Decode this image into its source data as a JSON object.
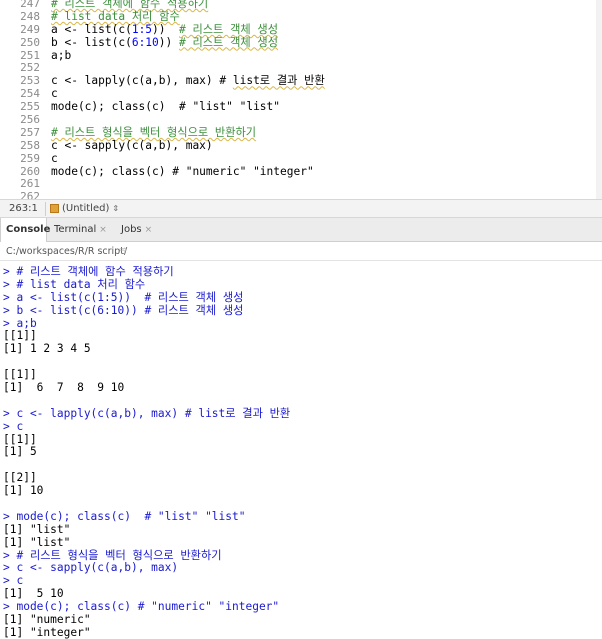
{
  "editor": {
    "lines": [
      {
        "n": "247",
        "segments": [
          {
            "t": "# 리스트 객체에 함수 적용하기",
            "c": "cmt",
            "s": true
          }
        ]
      },
      {
        "n": "248",
        "segments": [
          {
            "t": "# list data 처리 함수",
            "c": "cmt",
            "s": true
          }
        ]
      },
      {
        "n": "249",
        "segments": [
          {
            "t": "a <- list(c(",
            "c": ""
          },
          {
            "t": "1:5",
            "c": "num"
          },
          {
            "t": "))  ",
            "c": ""
          },
          {
            "t": "# 리스트 객체 생성",
            "c": "cmt",
            "s": true
          }
        ]
      },
      {
        "n": "250",
        "segments": [
          {
            "t": "b <- list(c(",
            "c": ""
          },
          {
            "t": "6:10",
            "c": "num"
          },
          {
            "t": ")) ",
            "c": ""
          },
          {
            "t": "# 리스트 객체 생성",
            "c": "cmt",
            "s": true
          }
        ]
      },
      {
        "n": "251",
        "segments": [
          {
            "t": "a;b",
            "c": ""
          }
        ]
      },
      {
        "n": "252",
        "segments": []
      },
      {
        "n": "253",
        "segments": [
          {
            "t": "c <- lapply(c(a,b), max) # ",
            "c": ""
          },
          {
            "t": "list로 결과 반환",
            "c": "",
            "s": true
          }
        ]
      },
      {
        "n": "254",
        "segments": [
          {
            "t": "c",
            "c": ""
          }
        ]
      },
      {
        "n": "255",
        "segments": [
          {
            "t": "mode(c); class(c)  # \"list\" \"list\"",
            "c": ""
          }
        ]
      },
      {
        "n": "256",
        "segments": []
      },
      {
        "n": "257",
        "segments": [
          {
            "t": "# 리스트 형식을 벡터 형식으로 반환하기",
            "c": "cmt",
            "s": true
          }
        ]
      },
      {
        "n": "258",
        "segments": [
          {
            "t": "c <- sapply(c(a,b), max)",
            "c": ""
          }
        ]
      },
      {
        "n": "259",
        "segments": [
          {
            "t": "c",
            "c": ""
          }
        ]
      },
      {
        "n": "260",
        "segments": [
          {
            "t": "mode(c); class(c) # \"numeric\" \"integer\"",
            "c": ""
          }
        ]
      },
      {
        "n": "261",
        "segments": []
      },
      {
        "n": "262",
        "segments": []
      }
    ]
  },
  "status": {
    "position": "263:1",
    "scope": "(Untitled)",
    "scope_chevron": "⇕"
  },
  "tabs": {
    "console": "Console",
    "terminal": "Terminal",
    "jobs": "Jobs",
    "close_glyph": "×"
  },
  "path": {
    "text": "C:/workspaces/R/R script/",
    "goto_glyph": "⇨"
  },
  "console": {
    "lines": [
      {
        "k": "input",
        "t": "> # 리스트 객체에 함수 적용하기"
      },
      {
        "k": "input",
        "t": "> # list data 처리 함수"
      },
      {
        "k": "input",
        "t": "> a <- list(c(1:5))  # 리스트 객체 생성"
      },
      {
        "k": "input",
        "t": "> b <- list(c(6:10)) # 리스트 객체 생성"
      },
      {
        "k": "input",
        "t": "> a;b"
      },
      {
        "k": "output",
        "t": "[[1]]"
      },
      {
        "k": "output",
        "t": "[1] 1 2 3 4 5"
      },
      {
        "k": "blank",
        "t": ""
      },
      {
        "k": "output",
        "t": "[[1]]"
      },
      {
        "k": "output",
        "t": "[1]  6  7  8  9 10"
      },
      {
        "k": "blank",
        "t": ""
      },
      {
        "k": "input",
        "t": "> c <- lapply(c(a,b), max) # list로 결과 반환"
      },
      {
        "k": "input",
        "t": "> c"
      },
      {
        "k": "output",
        "t": "[[1]]"
      },
      {
        "k": "output",
        "t": "[1] 5"
      },
      {
        "k": "blank",
        "t": ""
      },
      {
        "k": "output",
        "t": "[[2]]"
      },
      {
        "k": "output",
        "t": "[1] 10"
      },
      {
        "k": "blank",
        "t": ""
      },
      {
        "k": "input",
        "t": "> mode(c); class(c)  # \"list\" \"list\""
      },
      {
        "k": "output",
        "t": "[1] \"list\""
      },
      {
        "k": "output",
        "t": "[1] \"list\""
      },
      {
        "k": "input",
        "t": "> # 리스트 형식을 벡터 형식으로 반환하기"
      },
      {
        "k": "input",
        "t": "> c <- sapply(c(a,b), max)"
      },
      {
        "k": "input",
        "t": "> c"
      },
      {
        "k": "output",
        "t": "[1]  5 10"
      },
      {
        "k": "input",
        "t": "> mode(c); class(c) # \"numeric\" \"integer\""
      },
      {
        "k": "output",
        "t": "[1] \"numeric\""
      },
      {
        "k": "output",
        "t": "[1] \"integer\""
      }
    ]
  },
  "colors": {
    "comment": "#3c8f3c",
    "console_input": "#1a1ad0",
    "number": "#0000ff"
  }
}
